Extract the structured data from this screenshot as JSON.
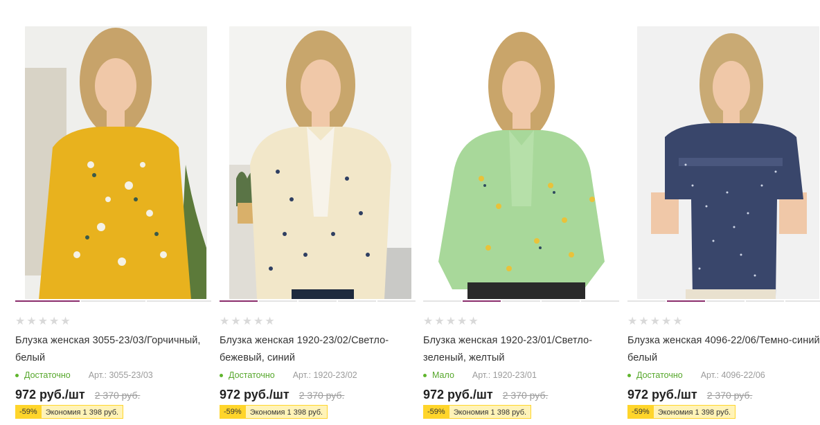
{
  "products": [
    {
      "title": "Блузка женская 3055-23/03/Горчичный, белый",
      "rating_stars": "★★★★★",
      "stock": "Достаточно",
      "article": "Арт.: 3055-23/03",
      "price": "972 руб./шт",
      "old_price": "2 370 руб.",
      "discount": "-59%",
      "savings": "Экономия 1 398 руб.",
      "colors": {
        "blouse": "#e8b21e",
        "print": "#f4f1e6",
        "bg": "#efefec",
        "stock_dot": "#5fb52d"
      },
      "icon": "product-photo"
    },
    {
      "title": "Блузка женская 1920-23/02/Светло-бежевый, синий",
      "rating_stars": "★★★★★",
      "stock": "Достаточно",
      "article": "Арт.: 1920-23/02",
      "price": "972 руб./шт",
      "old_price": "2 370 руб.",
      "discount": "-59%",
      "savings": "Экономия 1 398 руб.",
      "colors": {
        "blouse": "#f2e7c9",
        "print": "#2f3f62",
        "bg": "#f3f3f1",
        "stock_dot": "#5fb52d"
      },
      "icon": "product-photo"
    },
    {
      "title": "Блузка женская 1920-23/01/Светло-зеленый, желтый",
      "rating_stars": "★★★★★",
      "stock": "Мало",
      "article": "Арт.: 1920-23/01",
      "price": "972 руб./шт",
      "old_price": "2 370 руб.",
      "discount": "-59%",
      "savings": "Экономия 1 398 руб.",
      "colors": {
        "blouse": "#a8d89a",
        "print": "#e9c23a",
        "bg": "#ffffff",
        "stock_dot": "#5fb52d"
      },
      "icon": "product-photo"
    },
    {
      "title": "Блузка женская 4096-22/06/Темно-синий, белый",
      "rating_stars": "★★★★★",
      "stock": "Достаточно",
      "article": "Арт.: 4096-22/06",
      "price": "972 руб./шт",
      "old_price": "2 370 руб.",
      "discount": "-59%",
      "savings": "Экономия 1 398 руб.",
      "colors": {
        "blouse": "#39466b",
        "print": "#cfd6e6",
        "bg": "#f1f1f1",
        "stock_dot": "#5fb52d"
      },
      "icon": "product-photo"
    }
  ],
  "theme": {
    "accent": "#8a2c6b",
    "discount_bg": "#ffd52b",
    "savings_bg": "#fff3b8"
  }
}
